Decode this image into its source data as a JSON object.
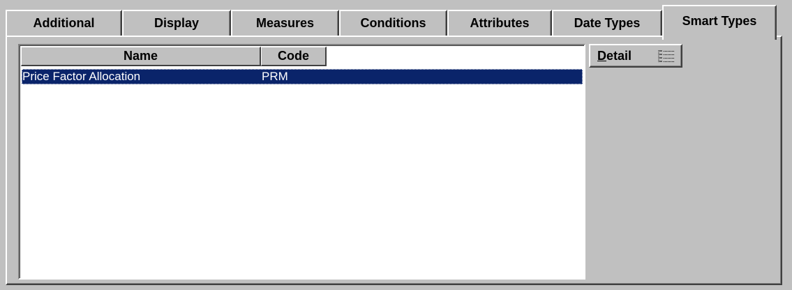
{
  "tabs": [
    {
      "label": "Additional",
      "active": false
    },
    {
      "label": "Display",
      "active": false
    },
    {
      "label": "Measures",
      "active": false
    },
    {
      "label": "Conditions",
      "active": false
    },
    {
      "label": "Attributes",
      "active": false
    },
    {
      "label": "Date Types",
      "active": false
    },
    {
      "label": "Smart Types",
      "active": true
    }
  ],
  "list": {
    "columns": {
      "name": "Name",
      "code": "Code"
    },
    "rows": [
      {
        "name": "Price Factor Allocation",
        "code": "PRM",
        "selected": true
      }
    ]
  },
  "detail_button": {
    "label_mnemonic": "D",
    "label_rest": "etail",
    "icon": "list-detail-icon"
  },
  "colors": {
    "face": "#c0c0c0",
    "selection": "#0a246a",
    "selection_text": "#ffffff",
    "list_background": "#ffffff"
  }
}
